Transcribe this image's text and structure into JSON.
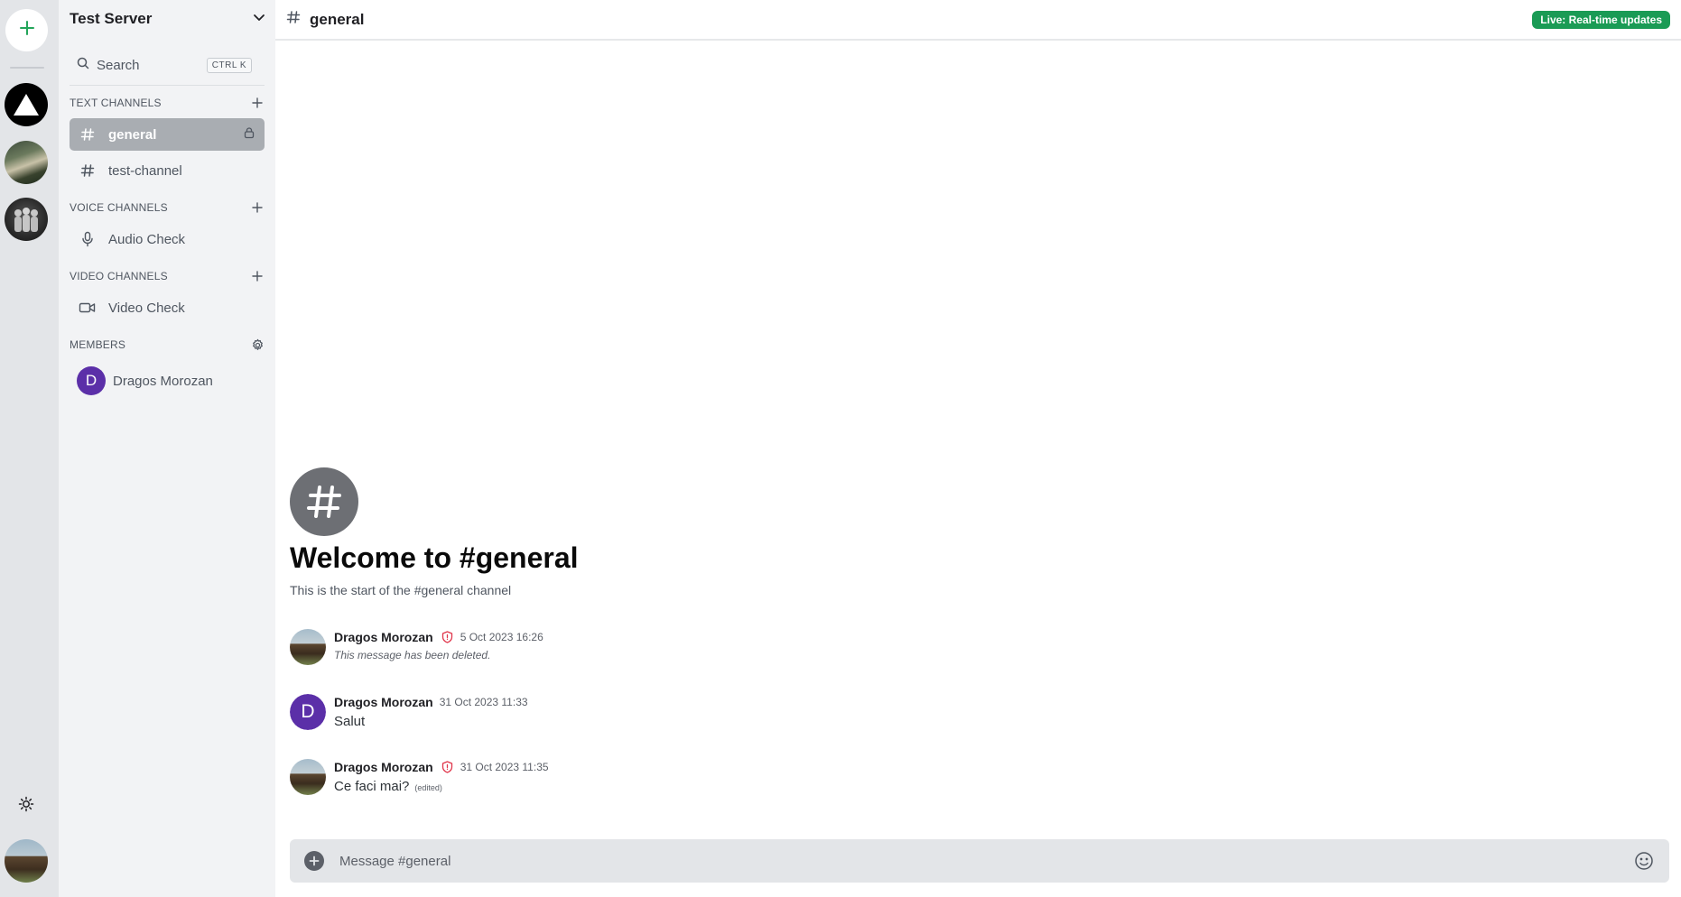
{
  "server": {
    "name": "Test Server"
  },
  "search": {
    "label": "Search",
    "shortcut": "CTRL K"
  },
  "sections": {
    "text": {
      "title": "TEXT CHANNELS"
    },
    "voice": {
      "title": "VOICE CHANNELS"
    },
    "video": {
      "title": "VIDEO CHANNELS"
    },
    "members": {
      "title": "MEMBERS"
    }
  },
  "channels": {
    "text": [
      {
        "name": "general",
        "active": true,
        "locked": true
      },
      {
        "name": "test-channel",
        "active": false
      }
    ],
    "voice": [
      {
        "name": "Audio Check"
      }
    ],
    "video": [
      {
        "name": "Video Check"
      }
    ]
  },
  "members": [
    {
      "name": "Dragos Morozan",
      "initial": "D",
      "color": "#5b2fa8"
    }
  ],
  "header": {
    "channel": "general",
    "live_badge": "Live: Real-time updates",
    "badge_color": "#1a9b55"
  },
  "welcome": {
    "title": "Welcome to #general",
    "subtitle": "This is the start of the #general channel"
  },
  "messages": [
    {
      "author": "Dragos Morozan",
      "admin": true,
      "avatar": "photo",
      "time": "5 Oct 2023 16:26",
      "body": "This message has been deleted.",
      "deleted": true
    },
    {
      "author": "Dragos Morozan",
      "admin": false,
      "avatar": "initial",
      "initial": "D",
      "time": "31 Oct 2023 11:33",
      "body": "Salut"
    },
    {
      "author": "Dragos Morozan",
      "admin": true,
      "avatar": "photo",
      "time": "31 Oct 2023 11:35",
      "body": "Ce faci mai?",
      "edited": "(edited)"
    }
  ],
  "composer": {
    "placeholder": "Message #general"
  },
  "icons": {
    "add_server": "plus-icon",
    "theme": "sun-icon",
    "server_menu": "chevron-down-icon",
    "search": "search-icon",
    "channel": "hash-icon",
    "lock": "lock-icon",
    "voice": "microphone-icon",
    "video": "video-icon",
    "settings": "gear-icon",
    "admin": "shield-icon",
    "emoji": "emoji-icon"
  },
  "colors": {
    "accent": "#23a55a",
    "admin_shield": "#e0364b"
  }
}
